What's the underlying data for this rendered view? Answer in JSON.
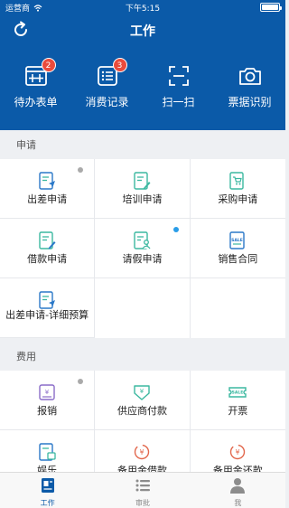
{
  "status_bar": {
    "carrier": "运营商",
    "time": "下午5:15"
  },
  "header": {
    "title": "工作",
    "refresh_icon": "refresh-icon"
  },
  "quick_actions": [
    {
      "label": "待办表单",
      "badge": "2",
      "icon": "calendar-grid-icon"
    },
    {
      "label": "消费记录",
      "badge": "3",
      "icon": "list-icon"
    },
    {
      "label": "扫一扫",
      "badge": "",
      "icon": "scan-icon"
    },
    {
      "label": "票据识别",
      "badge": "",
      "icon": "camera-icon"
    }
  ],
  "sections": [
    {
      "title": "申请",
      "items": [
        {
          "label": "出差申请",
          "icon": "travel-doc-icon",
          "dot": "#aaaaaa"
        },
        {
          "label": "培训申请",
          "icon": "training-doc-icon",
          "dot": ""
        },
        {
          "label": "采购申请",
          "icon": "purchase-doc-icon",
          "dot": ""
        },
        {
          "label": "借款申请",
          "icon": "loan-doc-icon",
          "dot": ""
        },
        {
          "label": "请假申请",
          "icon": "leave-doc-icon",
          "dot": "#2a9de8"
        },
        {
          "label": "销售合同",
          "icon": "sale-doc-icon",
          "dot": ""
        },
        {
          "label": "出差申请-详细预算",
          "icon": "travel-budget-icon",
          "dot": ""
        }
      ]
    },
    {
      "title": "费用",
      "items": [
        {
          "label": "报销",
          "icon": "reimburse-icon",
          "dot": "#aaaaaa"
        },
        {
          "label": "供应商付款",
          "icon": "supplier-pay-icon",
          "dot": ""
        },
        {
          "label": "开票",
          "icon": "invoice-icon",
          "dot": ""
        },
        {
          "label": "娱乐",
          "icon": "entertainment-icon",
          "dot": ""
        },
        {
          "label": "备用金借款",
          "icon": "petty-loan-icon",
          "dot": ""
        },
        {
          "label": "备用金还款",
          "icon": "petty-repay-icon",
          "dot": ""
        }
      ]
    }
  ],
  "tabbar": [
    {
      "label": "工作",
      "icon": "work-icon",
      "active": true
    },
    {
      "label": "审批",
      "icon": "approval-icon",
      "active": false
    },
    {
      "label": "我",
      "icon": "profile-icon",
      "active": false
    }
  ],
  "colors": {
    "brand": "#0b5aa8",
    "badge": "#e94b3c",
    "icon_green": "#3bb8a0",
    "icon_blue": "#2a78c8",
    "icon_purple": "#8a6cc8",
    "icon_red": "#e2674c"
  }
}
